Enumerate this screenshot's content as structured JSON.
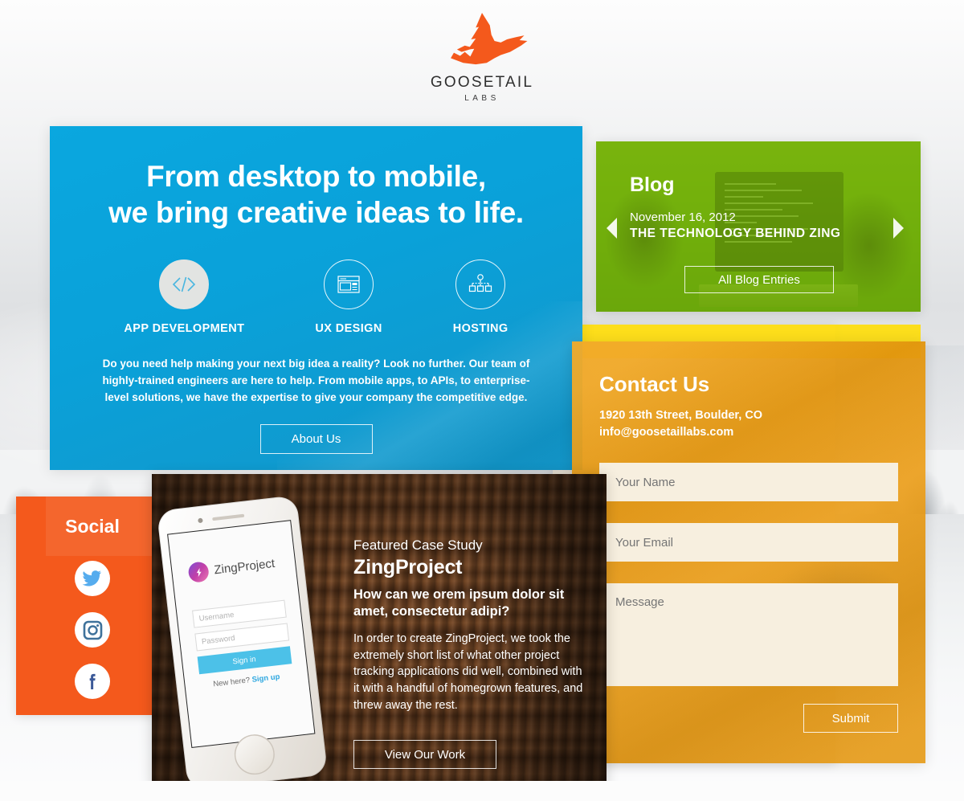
{
  "brand": {
    "name": "GOOSETAIL",
    "sub": "LABS",
    "logo_icon": "flying-goose-icon",
    "logo_color": "#f4591c"
  },
  "hero": {
    "headline_line1": "From desktop to mobile,",
    "headline_line2": "we bring creative ideas to life.",
    "services": [
      {
        "label": "APP DEVELOPMENT",
        "icon": "code-brackets-icon",
        "active": true
      },
      {
        "label": "UX DESIGN",
        "icon": "browser-window-icon",
        "active": false
      },
      {
        "label": "HOSTING",
        "icon": "sitemap-icon",
        "active": false
      }
    ],
    "body": "Do you need help making your next big idea a reality? Look no further. Our team of highly-trained engineers are here to help. From mobile apps, to APIs, to enterprise-level solutions, we have the expertise to give your company the competitive edge.",
    "cta": "About Us",
    "color": "#0aa5dd"
  },
  "blog": {
    "heading": "Blog",
    "date": "November 16, 2012",
    "post_title": "THE TECHNOLOGY BEHIND ZING",
    "cta": "All Blog Entries",
    "prev_icon": "chevron-left-icon",
    "next_icon": "chevron-right-icon",
    "color": "#6fae0c"
  },
  "contact": {
    "heading": "Contact Us",
    "address": "1920 13th Street, Boulder, CO",
    "email": "info@goosetaillabs.com",
    "name_placeholder": "Your Name",
    "email_placeholder": "Your Email",
    "message_placeholder": "Message",
    "submit": "Submit",
    "color": "#eb980e"
  },
  "social": {
    "heading": "Social",
    "links": [
      {
        "name": "twitter",
        "icon": "twitter-icon",
        "color": "#55acee"
      },
      {
        "name": "instagram",
        "icon": "instagram-icon",
        "color": "#3f729b"
      },
      {
        "name": "facebook",
        "icon": "facebook-icon",
        "color": "#3b5998"
      }
    ],
    "color": "#f4591c"
  },
  "case_study": {
    "eyebrow": "Featured Case Study",
    "title": "ZingProject",
    "question": "How can we orem ipsum dolor sit amet, consectetur adipi?",
    "body": "In order to create ZingProject, we took the extremely short list of what other project tracking applications did well, combined with it with a handful of homegrown features, and threw away the rest.",
    "cta": "View Our Work",
    "phone": {
      "app_name": "ZingProject",
      "username_placeholder": "Username",
      "password_placeholder": "Password",
      "signin_label": "Sign in",
      "signup_prompt": "New here? ",
      "signup_link": "Sign up"
    }
  }
}
